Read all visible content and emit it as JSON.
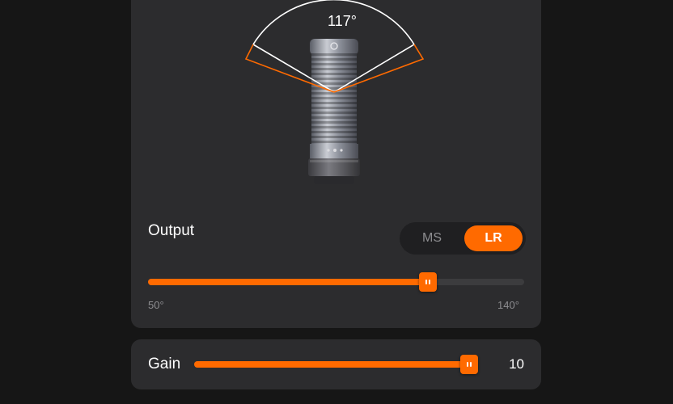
{
  "pattern": {
    "angle_label": "117°",
    "angle_degrees": 117,
    "colors": {
      "pickup_arc": "#ffffff",
      "outer_boundary": "#ff6a00"
    }
  },
  "output": {
    "label": "Output",
    "modes": [
      "MS",
      "LR"
    ],
    "selected_mode": "LR"
  },
  "angle_slider": {
    "min_label": "50°",
    "max_label": "140°",
    "min": 50,
    "max": 140,
    "value": 117
  },
  "gain": {
    "label": "Gain",
    "value_label": "10",
    "value": 10,
    "fill_fraction": 1.0
  },
  "colors": {
    "accent": "#ff6a00",
    "card": "#2c2c2e",
    "background": "#161616",
    "muted_text": "#8d8d90"
  },
  "icons": [
    "microphone-illustration",
    "slider-grip-icon"
  ]
}
